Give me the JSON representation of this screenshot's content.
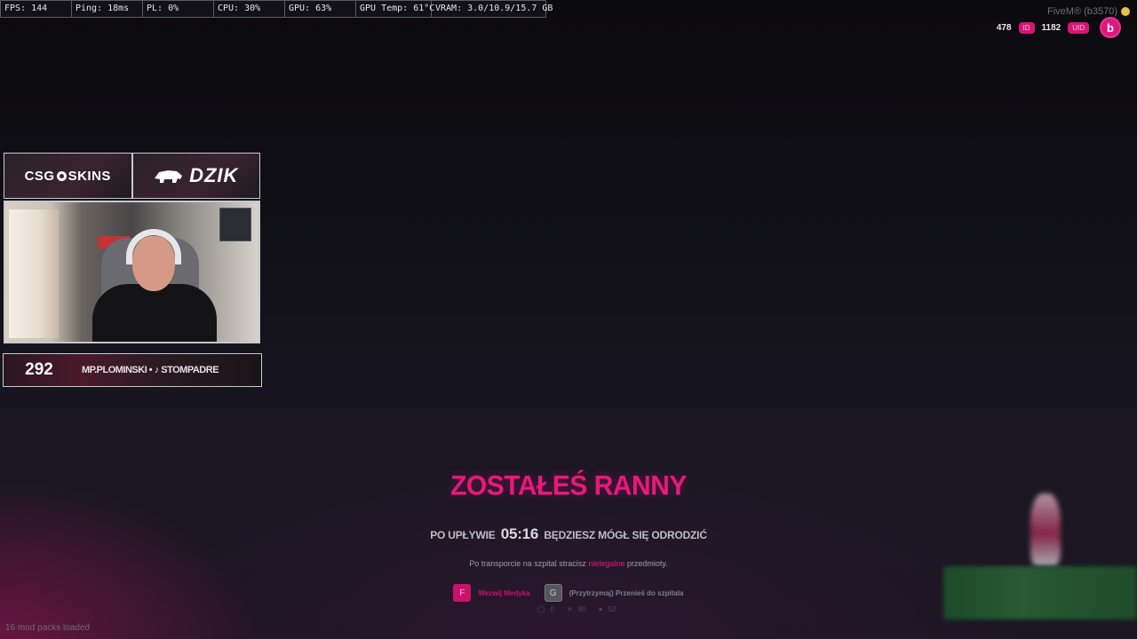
{
  "perf": {
    "fps": "FPS: 144",
    "ping": "Ping: 18ms",
    "pl": "PL: 0%",
    "cpu": "CPU: 30%",
    "gpu": "GPU: 63%",
    "gpu_temp": "GPU Temp: 61°C",
    "vram": "VRAM: 3.0/10.9/15.7 GB"
  },
  "top_right": {
    "fivem": "FiveM® (b3570)",
    "id_value": "478",
    "id_label": "ID",
    "uid_value": "1182",
    "uid_label": "UID",
    "logo_letter": "b"
  },
  "stream_overlay": {
    "sponsor_left": "SKINS",
    "sponsor_left_prefix": "CS",
    "sponsor_left_g": "G",
    "sponsor_right": "DZIK",
    "counter": "292",
    "social": "MP.PLOMINSKI • ♪ STOMPADRE"
  },
  "death_screen": {
    "title": "ZOSTAŁEŚ RANNY",
    "respawn_before": "PO UPŁYWIE",
    "respawn_timer": "05:16",
    "respawn_after": "BĘDZIESZ MÓGŁ SIĘ ODRODZIĆ",
    "note_before": "Po transporcie na szpital stracisz",
    "note_highlight": "nielegalne",
    "note_after": "przedmioty.",
    "action_medic_key": "F",
    "action_medic_label": "Wezwij Medyka",
    "action_hospital_key": "G",
    "action_hospital_label": "(Przytrzymaj) Przenieś do szpitala",
    "stat_1": "0",
    "stat_2": "90",
    "stat_3": "52"
  },
  "footer": {
    "modpacks": "16 mod packs loaded"
  },
  "colors": {
    "accent": "#e6197c",
    "panel_border": "#c8c8d0"
  }
}
